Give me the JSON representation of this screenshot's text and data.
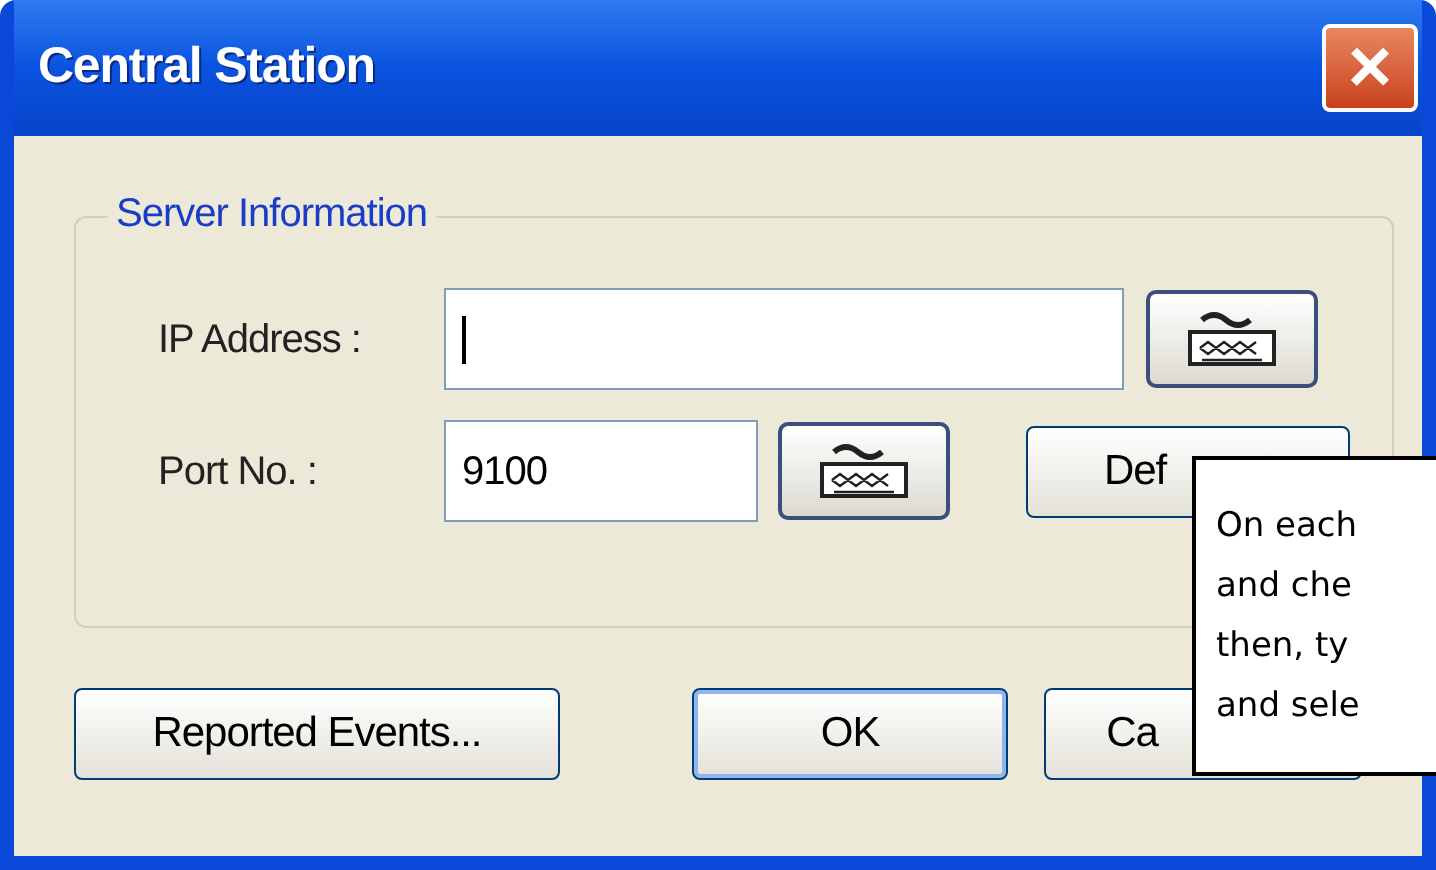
{
  "window": {
    "title": "Central Station",
    "close": "×"
  },
  "group": {
    "title": "Server Information",
    "ip": {
      "label": "IP Address :",
      "focused": true
    },
    "port": {
      "label": "Port No. :",
      "value": "9100"
    },
    "default_button": "Def"
  },
  "buttons": [
    {
      "label": "Reported Events...",
      "default": false
    },
    {
      "label": "OK",
      "default": true
    },
    {
      "label": "Ca",
      "default": false
    }
  ],
  "note": {
    "lines": [
      "On each",
      "and che",
      "then, ty",
      "and sele"
    ]
  }
}
